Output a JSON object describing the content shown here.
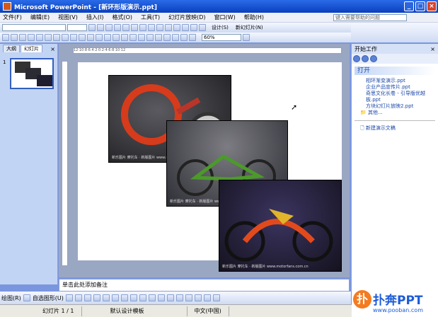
{
  "window": {
    "title": "Microsoft PowerPoint - [新环形版演示.ppt]"
  },
  "menu": {
    "items": [
      "文件(F)",
      "编辑(E)",
      "视图(V)",
      "插入(I)",
      "格式(O)",
      "工具(T)",
      "幻灯片放映(D)",
      "窗口(W)",
      "帮助(H)"
    ],
    "help_placeholder": "键入需要帮助的问题"
  },
  "toolbar": {
    "zoom": "60%",
    "new_slide_label": "新幻灯片(N)",
    "design_label": "设计(S)"
  },
  "left_panel": {
    "tabs": [
      "大纲",
      "幻灯片"
    ],
    "slide_number": "1"
  },
  "slide": {
    "captions": [
      "新乐图片 摩托车 · 新版图片  www.motorfans.com.cn",
      "新乐图片 摩托车 · 新版图片  www.motorfans.com.cn",
      "新乐图片 摩托车 · 新版图片  www.motorfans.com.cn"
    ]
  },
  "notes": {
    "placeholder": "单击此处添加备注"
  },
  "task_pane": {
    "header": "开始工作",
    "section_title": "打开",
    "files": [
      "相环渐变演示.ppt",
      "企业产品宣传片.ppt",
      "奇思文化长卷 - 引导版优越板.ppt",
      "方块幻灯片放映2.ppt"
    ],
    "more": "其他...",
    "new_presentation": "新建演示文稿"
  },
  "drawbar": {
    "draw_label": "绘图(R)",
    "autoshape_label": "自选图形(U)"
  },
  "status": {
    "slide_position": "幻灯片 1 / 1",
    "design": "默认设计模板",
    "language": "中文(中国)"
  },
  "logo": {
    "brand": "扑奔PPT",
    "url": "www.pooban.com"
  }
}
